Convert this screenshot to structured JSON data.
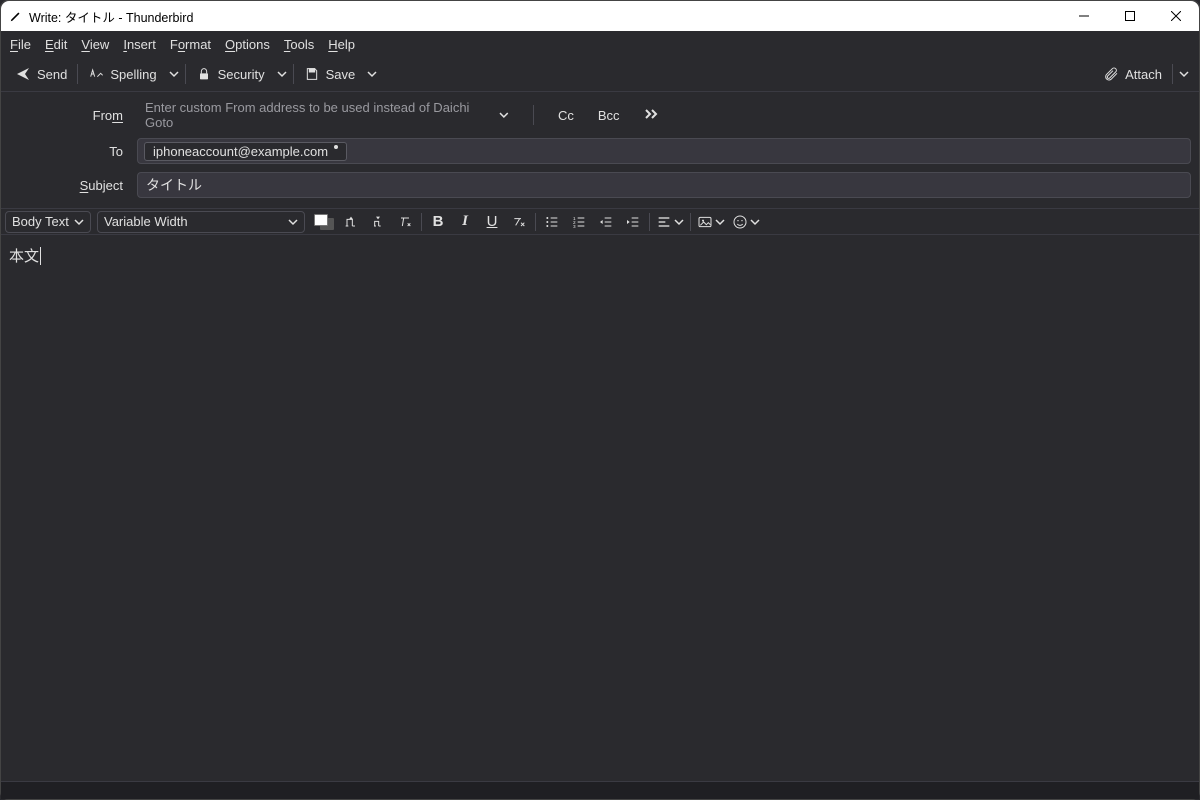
{
  "window": {
    "title": "Write: タイトル - Thunderbird"
  },
  "menu": {
    "file": "File",
    "edit": "Edit",
    "view": "View",
    "insert": "Insert",
    "format": "Format",
    "options": "Options",
    "tools": "Tools",
    "help": "Help"
  },
  "toolbar": {
    "send": "Send",
    "spelling": "Spelling",
    "security": "Security",
    "save": "Save",
    "attach": "Attach"
  },
  "fields": {
    "from_label": "From",
    "from_placeholder": "Enter custom From address to be used instead of Daichi Goto",
    "cc": "Cc",
    "bcc": "Bcc",
    "to_label": "To",
    "to_value": "iphoneaccount@example.com",
    "subject_label": "Subject",
    "subject_value": "タイトル"
  },
  "format": {
    "paragraph_style": "Body Text",
    "font_family": "Variable Width"
  },
  "body": {
    "text": "本文"
  }
}
